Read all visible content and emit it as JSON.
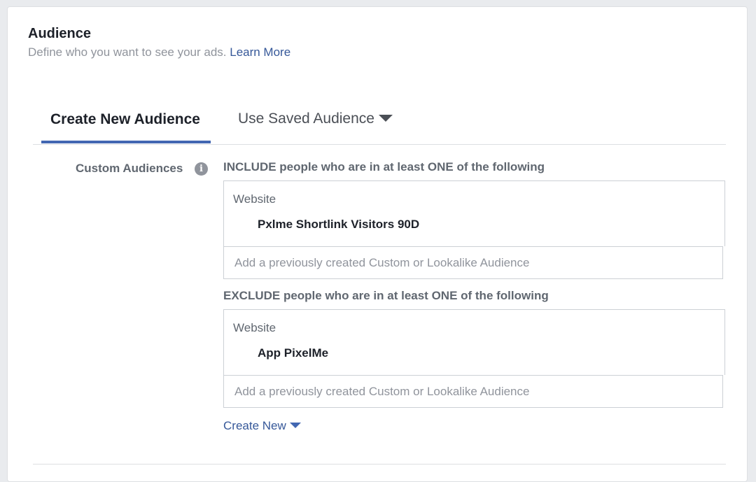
{
  "header": {
    "title": "Audience",
    "subtitle": "Define who you want to see your ads.",
    "learn_more": "Learn More"
  },
  "tabs": {
    "create_new": "Create New Audience",
    "use_saved": "Use Saved Audience"
  },
  "custom_audiences": {
    "label": "Custom Audiences",
    "info_icon": "info-icon",
    "include": {
      "heading": "INCLUDE people who are in at least ONE of the following",
      "type": "Website",
      "audience": "Pxlme Shortlink Visitors 90D",
      "placeholder": "Add a previously created Custom or Lookalike Audience"
    },
    "exclude": {
      "heading": "EXCLUDE people who are in at least ONE of the following",
      "type": "Website",
      "audience": "App PixelMe",
      "placeholder": "Add a previously created Custom or Lookalike Audience"
    },
    "create_new": "Create New"
  },
  "colors": {
    "accent": "#4267b2",
    "link": "#365899",
    "text_primary": "#1d2129",
    "text_secondary": "#606770",
    "placeholder": "#90949c"
  }
}
